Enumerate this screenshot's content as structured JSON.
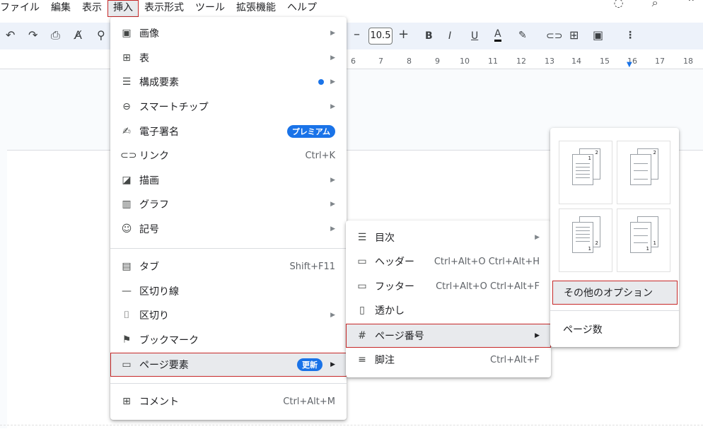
{
  "menubar": [
    "ファイル",
    "編集",
    "表示",
    "挿入",
    "表示形式",
    "ツール",
    "拡張機能",
    "ヘルプ"
  ],
  "toolbar": {
    "font_size": "10.5"
  },
  "ruler": [
    "6",
    "7",
    "8",
    "9",
    "10",
    "11",
    "12",
    "13",
    "14",
    "15",
    "16",
    "17",
    "18"
  ],
  "insert_menu": {
    "items": [
      {
        "icon": "image-icon",
        "label": "画像"
      },
      {
        "icon": "table-icon",
        "label": "表"
      },
      {
        "icon": "building-blocks-icon",
        "label": "構成要素"
      },
      {
        "icon": "smart-chip-icon",
        "label": "スマートチップ"
      },
      {
        "icon": "esignature-icon",
        "label": "電子署名",
        "badge": "プレミアム"
      },
      {
        "icon": "link-icon",
        "label": "リンク",
        "shortcut": "Ctrl+K"
      },
      {
        "icon": "drawing-icon",
        "label": "描画"
      },
      {
        "icon": "chart-icon",
        "label": "グラフ"
      },
      {
        "icon": "emoji-icon",
        "label": "記号"
      },
      {
        "icon": "tab-icon",
        "label": "タブ",
        "shortcut": "Shift+F11"
      },
      {
        "icon": "horizontal-line-icon",
        "label": "区切り線"
      },
      {
        "icon": "break-icon",
        "label": "区切り"
      },
      {
        "icon": "bookmark-icon",
        "label": "ブックマーク"
      },
      {
        "icon": "page-elements-icon",
        "label": "ページ要素",
        "badge": "更新"
      },
      {
        "icon": "comment-icon",
        "label": "コメント",
        "shortcut": "Ctrl+Alt+M"
      }
    ]
  },
  "page_elements_menu": {
    "items": [
      {
        "icon": "toc-icon",
        "label": "目次"
      },
      {
        "icon": "header-icon",
        "label": "ヘッダー",
        "shortcut": "Ctrl+Alt+O Ctrl+Alt+H"
      },
      {
        "icon": "footer-icon",
        "label": "フッター",
        "shortcut": "Ctrl+Alt+O Ctrl+Alt+F"
      },
      {
        "icon": "watermark-icon",
        "label": "透かし"
      },
      {
        "icon": "hash-icon",
        "label": "ページ番号"
      },
      {
        "icon": "footnote-icon",
        "label": "脚注",
        "shortcut": "Ctrl+Alt+F"
      }
    ]
  },
  "page_number_menu": {
    "thumb_numbers": [
      "1",
      "2",
      "1",
      "2",
      "1",
      "2",
      "1",
      "1"
    ],
    "more_options": "その他のオプション",
    "page_count": "ページ数"
  }
}
